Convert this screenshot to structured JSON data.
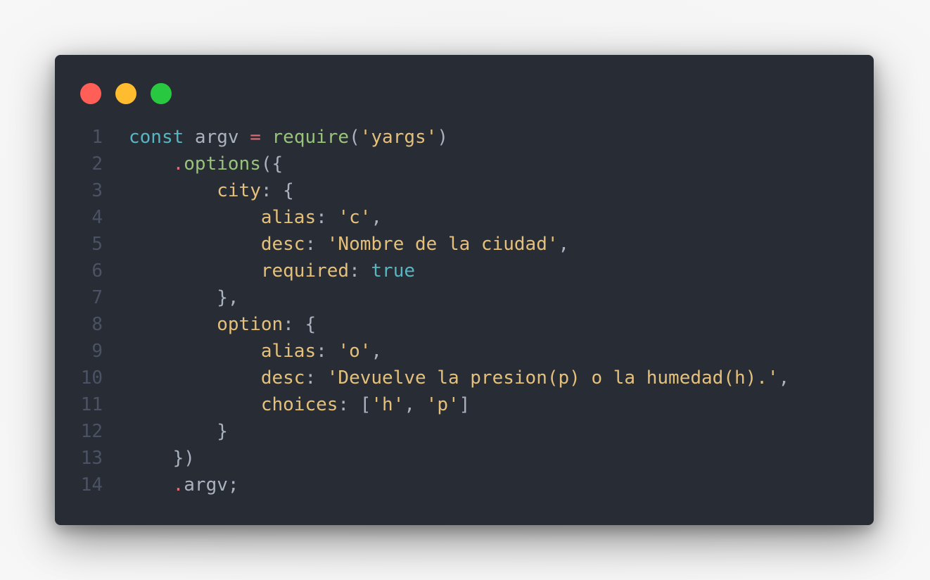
{
  "window_controls": {
    "close_color": "#ff5f57",
    "minimize_color": "#febc2e",
    "maximize_color": "#28c840"
  },
  "colors": {
    "background": "#282c35",
    "line_number": "#4b5263",
    "keyword": "#56b6c2",
    "function": "#98c379",
    "string": "#e5c07b",
    "operator": "#e06c75",
    "punctuation": "#abb2bf"
  },
  "code": {
    "line_numbers": [
      "1",
      "2",
      "3",
      "4",
      "5",
      "6",
      "7",
      "8",
      "9",
      "10",
      "11",
      "12",
      "13",
      "14"
    ],
    "lines": [
      [
        {
          "t": "const",
          "c": "kw"
        },
        {
          "t": " argv ",
          "c": "pn"
        },
        {
          "t": "=",
          "c": "op"
        },
        {
          "t": " ",
          "c": "pn"
        },
        {
          "t": "require",
          "c": "fn"
        },
        {
          "t": "(",
          "c": "pn"
        },
        {
          "t": "'yargs'",
          "c": "str"
        },
        {
          "t": ")",
          "c": "pn"
        }
      ],
      [
        {
          "t": "    ",
          "c": "pn"
        },
        {
          "t": ".",
          "c": "op"
        },
        {
          "t": "options",
          "c": "fn"
        },
        {
          "t": "({",
          "c": "pn"
        }
      ],
      [
        {
          "t": "        ",
          "c": "pn"
        },
        {
          "t": "city",
          "c": "prop"
        },
        {
          "t": ": {",
          "c": "pn"
        }
      ],
      [
        {
          "t": "            ",
          "c": "pn"
        },
        {
          "t": "alias",
          "c": "prop"
        },
        {
          "t": ": ",
          "c": "pn"
        },
        {
          "t": "'c'",
          "c": "str"
        },
        {
          "t": ",",
          "c": "pn"
        }
      ],
      [
        {
          "t": "            ",
          "c": "pn"
        },
        {
          "t": "desc",
          "c": "prop"
        },
        {
          "t": ": ",
          "c": "pn"
        },
        {
          "t": "'Nombre de la ciudad'",
          "c": "str"
        },
        {
          "t": ",",
          "c": "pn"
        }
      ],
      [
        {
          "t": "            ",
          "c": "pn"
        },
        {
          "t": "required",
          "c": "prop"
        },
        {
          "t": ": ",
          "c": "pn"
        },
        {
          "t": "true",
          "c": "bool"
        }
      ],
      [
        {
          "t": "        ",
          "c": "pn"
        },
        {
          "t": "},",
          "c": "pn"
        }
      ],
      [
        {
          "t": "        ",
          "c": "pn"
        },
        {
          "t": "option",
          "c": "prop"
        },
        {
          "t": ": {",
          "c": "pn"
        }
      ],
      [
        {
          "t": "            ",
          "c": "pn"
        },
        {
          "t": "alias",
          "c": "prop"
        },
        {
          "t": ": ",
          "c": "pn"
        },
        {
          "t": "'o'",
          "c": "str"
        },
        {
          "t": ",",
          "c": "pn"
        }
      ],
      [
        {
          "t": "            ",
          "c": "pn"
        },
        {
          "t": "desc",
          "c": "prop"
        },
        {
          "t": ": ",
          "c": "pn"
        },
        {
          "t": "'Devuelve la presion(p) o la humedad(h).'",
          "c": "str"
        },
        {
          "t": ",",
          "c": "pn"
        }
      ],
      [
        {
          "t": "            ",
          "c": "pn"
        },
        {
          "t": "choices",
          "c": "prop"
        },
        {
          "t": ": [",
          "c": "pn"
        },
        {
          "t": "'h'",
          "c": "str"
        },
        {
          "t": ", ",
          "c": "pn"
        },
        {
          "t": "'p'",
          "c": "str"
        },
        {
          "t": "]",
          "c": "pn"
        }
      ],
      [
        {
          "t": "        ",
          "c": "pn"
        },
        {
          "t": "}",
          "c": "pn"
        }
      ],
      [
        {
          "t": "    ",
          "c": "pn"
        },
        {
          "t": "})",
          "c": "pn"
        }
      ],
      [
        {
          "t": "    ",
          "c": "pn"
        },
        {
          "t": ".",
          "c": "op"
        },
        {
          "t": "argv;",
          "c": "pn"
        }
      ]
    ]
  }
}
